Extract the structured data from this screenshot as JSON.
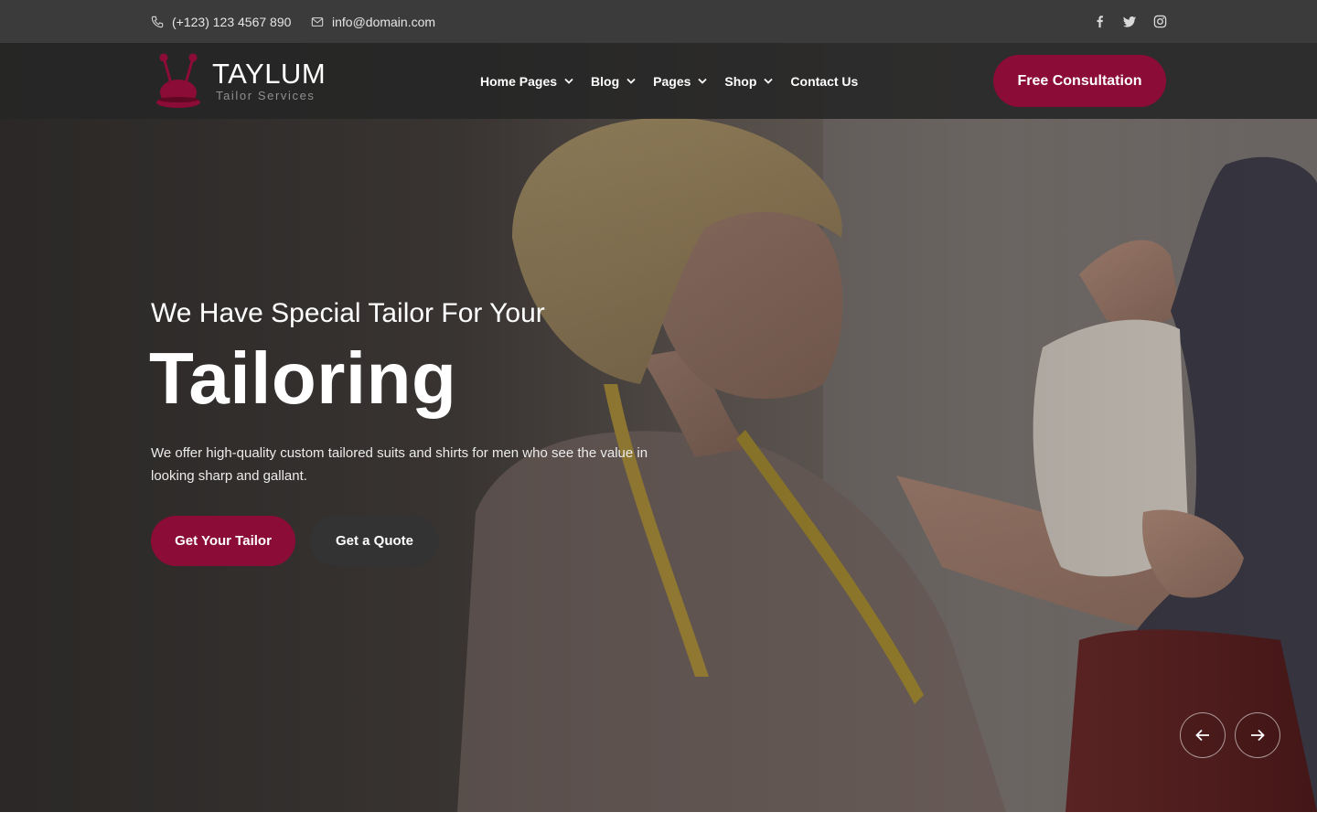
{
  "topbar": {
    "phone": "(+123) 123 4567 890",
    "email": "info@domain.com",
    "socials": [
      "facebook-icon",
      "twitter-icon",
      "instagram-icon"
    ]
  },
  "brand": {
    "name": "TAYLUM",
    "tagline": "Tailor Services",
    "accent": "#8b0c36"
  },
  "nav": {
    "items": [
      {
        "label": "Home Pages",
        "dropdown": true
      },
      {
        "label": "Blog",
        "dropdown": true
      },
      {
        "label": "Pages",
        "dropdown": true
      },
      {
        "label": "Shop",
        "dropdown": true
      },
      {
        "label": "Contact Us",
        "dropdown": false
      }
    ],
    "cta": "Free Consultation"
  },
  "hero": {
    "eyebrow": "We Have Special Tailor For Your",
    "headline": "Tailoring",
    "description": "We offer high-quality custom tailored suits and shirts for men who see the value in looking sharp and gallant.",
    "primary_button": "Get Your Tailor",
    "secondary_button": "Get a Quote",
    "slider_prev": "arrow-left-icon",
    "slider_next": "arrow-right-icon"
  },
  "colors": {
    "topbar_bg": "#3b3b3b",
    "navbar_bg": "#262626",
    "primary": "#8b0c36",
    "secondary_button": "#333333"
  }
}
